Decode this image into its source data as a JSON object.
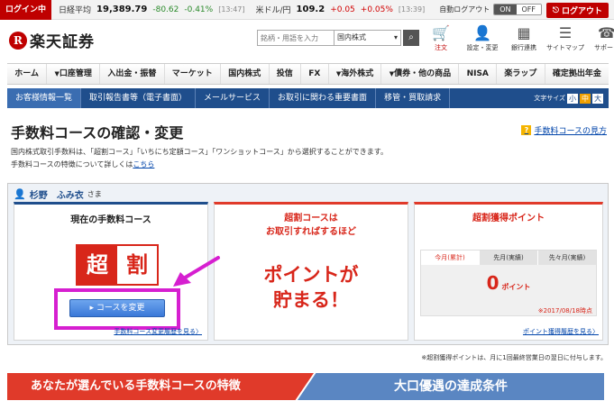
{
  "topbar": {
    "login_status": "ログイン中",
    "nikkei_label": "日経平均",
    "nikkei_value": "19,389.79",
    "nikkei_change": "-80.62",
    "nikkei_pct": "-0.41%",
    "nikkei_time": "[13:47]",
    "usdjpy_label": "米ドル/円",
    "usdjpy_value": "109.2",
    "usdjpy_change": "+0.05",
    "usdjpy_pct": "+0.05%",
    "usdjpy_time": "[13:39]",
    "auto_logout_label": "自動ログアウト",
    "toggle_on": "ON",
    "toggle_off": "OFF",
    "logout_label": "ログアウト"
  },
  "header": {
    "logo_mark": "R",
    "logo_text": "楽天証券",
    "search_placeholder": "銘柄・用語を入力",
    "search_category": "国内株式",
    "icons": [
      {
        "label": "注文",
        "icon": "cart-icon"
      },
      {
        "label": "設定・変更",
        "icon": "person-icon"
      },
      {
        "label": "銀行連携",
        "icon": "bank-icon"
      },
      {
        "label": "サイトマップ",
        "icon": "sitemap-icon"
      },
      {
        "label": "サポート",
        "icon": "support-icon"
      }
    ]
  },
  "mainnav": [
    "ホーム",
    "口座管理",
    "入出金・振替",
    "マーケット",
    "国内株式",
    "投信",
    "FX",
    "海外株式",
    "債券・他の商品",
    "NISA",
    "楽ラップ",
    "確定拠出年金"
  ],
  "subnav": {
    "items": [
      "お客様情報一覧",
      "取引報告書等（電子書面）",
      "メールサービス",
      "お取引に関わる重要書面",
      "移管・買取請求"
    ],
    "fontsize_label": "文字サイズ",
    "fontsize_options": [
      "小",
      "中",
      "大"
    ]
  },
  "page": {
    "title": "手数料コースの確認・変更",
    "help_link": "手数料コースの見方",
    "desc_line1": "国内株式取引手数料は、「超割コース」「いちにち定額コース」「ワンショットコース」から選択することができます。",
    "desc_line2_prefix": "手数料コースの特徴について詳しくは",
    "desc_link": "こちら"
  },
  "user": {
    "name": "杉野　ふみ衣",
    "suffix": "さま"
  },
  "current_course": {
    "title": "現在の手数料コース",
    "badge_left": "超",
    "badge_right": "割",
    "change_button": "コースを変更",
    "history_link": "手数料コース変更履歴を見る"
  },
  "promo": {
    "line1": "超割コースは",
    "line2": "お取引すればするほど",
    "big1": "ポイントが",
    "big2": "貯まる！"
  },
  "points": {
    "title": "超割獲得ポイント",
    "tabs": [
      "今月(累計)",
      "先月(実績)",
      "先々月(実績)"
    ],
    "value": "0",
    "unit": "ポイント",
    "as_of": "※2017/08/18時点",
    "history_link": "ポイント獲得履歴を見る"
  },
  "note": "※超割獲得ポイントは、月に1回最終営業日の翌日に付与します。",
  "banners": {
    "left": "あなたが選んでいる手数料コースの特徴",
    "right": "大口優遇の達成条件"
  },
  "colors": {
    "brand_red": "#bf0000",
    "nav_blue": "#1f4e8c",
    "highlight_magenta": "#d61fd0"
  }
}
